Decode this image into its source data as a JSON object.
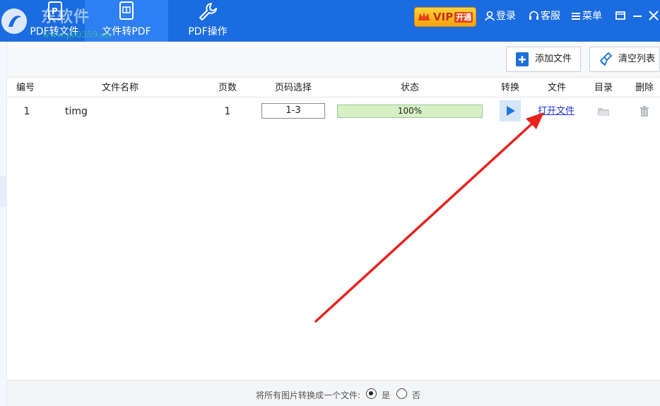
{
  "topbar": {
    "tabs": [
      {
        "label": "PDF转文件",
        "icon": "pdf-to-file-icon"
      },
      {
        "label": "文件转PDF",
        "icon": "file-to-pdf-icon"
      },
      {
        "label": "PDF操作",
        "icon": "wrench-icon"
      }
    ],
    "watermark_text": "东软件",
    "watermark_url": "www.pc0359.cn",
    "vip_label": "VIP",
    "vip_open": "开通",
    "login_label": "登录",
    "service_label": "客服",
    "menu_label": "菜单"
  },
  "toolbar": {
    "add_file_label": "添加文件",
    "clear_list_label": "清空列表"
  },
  "table": {
    "columns": [
      "编号",
      "文件名称",
      "页数",
      "页码选择",
      "状态",
      "转换",
      "文件",
      "目录",
      "删除"
    ],
    "rows": [
      {
        "index": "1",
        "name": "timg",
        "pages": "1",
        "page_range": "1-3",
        "status": "100%",
        "progress": 1.0,
        "file_action": "打开文件"
      }
    ]
  },
  "footer": {
    "label": "将所有图片转换成一个文件:",
    "option_yes": "是",
    "option_no": "否",
    "selected": "是"
  },
  "colors": {
    "topbar": "#1b6ce0",
    "active_tab": "#2e7ff2",
    "progress_fill": "#d6f0c4",
    "link": "#2532d6",
    "arrow": "#e8221e"
  }
}
